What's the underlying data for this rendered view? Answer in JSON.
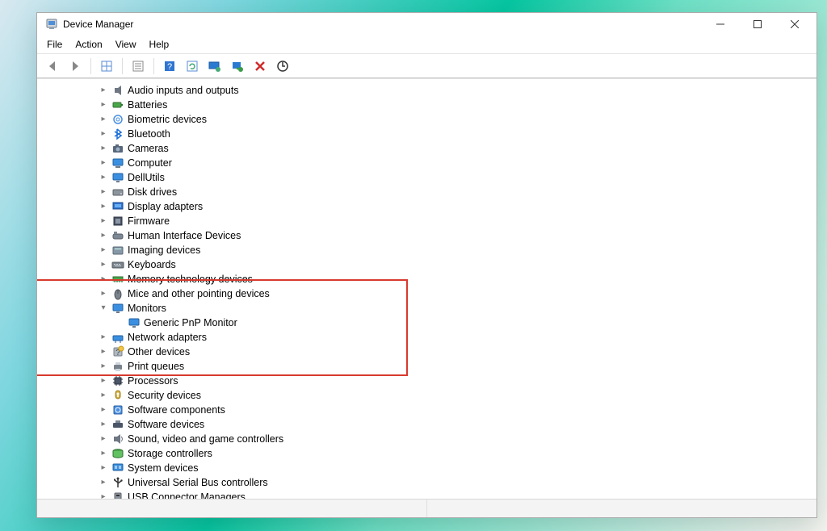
{
  "window": {
    "title": "Device Manager",
    "controls": {
      "minimize": "minimize",
      "maximize": "maximize",
      "close": "close"
    }
  },
  "menubar": [
    "File",
    "Action",
    "View",
    "Help"
  ],
  "toolbar": {
    "back": "Back",
    "forward": "Forward",
    "up_show": "Show hidden devices",
    "properties": "Properties",
    "help": "Help",
    "refresh": "Refresh",
    "update_driver": "Update driver",
    "uninstall": "Uninstall device",
    "disable": "Disable device",
    "scan": "Scan for hardware changes"
  },
  "tree": [
    {
      "label": "Audio inputs and outputs",
      "icon": "speaker",
      "state": "collapsed"
    },
    {
      "label": "Batteries",
      "icon": "battery",
      "state": "collapsed"
    },
    {
      "label": "Biometric devices",
      "icon": "biometric",
      "state": "collapsed"
    },
    {
      "label": "Bluetooth",
      "icon": "bluetooth",
      "state": "collapsed"
    },
    {
      "label": "Cameras",
      "icon": "camera",
      "state": "collapsed"
    },
    {
      "label": "Computer",
      "icon": "computer",
      "state": "collapsed"
    },
    {
      "label": "DellUtils",
      "icon": "monitor",
      "state": "collapsed"
    },
    {
      "label": "Disk drives",
      "icon": "disk",
      "state": "collapsed"
    },
    {
      "label": "Display adapters",
      "icon": "display",
      "state": "collapsed"
    },
    {
      "label": "Firmware",
      "icon": "firmware",
      "state": "collapsed"
    },
    {
      "label": "Human Interface Devices",
      "icon": "hid",
      "state": "collapsed"
    },
    {
      "label": "Imaging devices",
      "icon": "imaging",
      "state": "collapsed"
    },
    {
      "label": "Keyboards",
      "icon": "keyboard",
      "state": "collapsed"
    },
    {
      "label": "Memory technology devices",
      "icon": "memory",
      "state": "collapsed"
    },
    {
      "label": "Mice and other pointing devices",
      "icon": "mouse",
      "state": "collapsed"
    },
    {
      "label": "Monitors",
      "icon": "monitor",
      "state": "expanded",
      "children": [
        {
          "label": "Generic PnP Monitor",
          "icon": "monitor"
        }
      ]
    },
    {
      "label": "Network adapters",
      "icon": "network",
      "state": "collapsed"
    },
    {
      "label": "Other devices",
      "icon": "other",
      "state": "collapsed"
    },
    {
      "label": "Print queues",
      "icon": "printer",
      "state": "collapsed"
    },
    {
      "label": "Processors",
      "icon": "cpu",
      "state": "collapsed"
    },
    {
      "label": "Security devices",
      "icon": "security",
      "state": "collapsed"
    },
    {
      "label": "Software components",
      "icon": "softcomp",
      "state": "collapsed"
    },
    {
      "label": "Software devices",
      "icon": "softdev",
      "state": "collapsed"
    },
    {
      "label": "Sound, video and game controllers",
      "icon": "sound",
      "state": "collapsed"
    },
    {
      "label": "Storage controllers",
      "icon": "storage",
      "state": "collapsed"
    },
    {
      "label": "System devices",
      "icon": "system",
      "state": "collapsed"
    },
    {
      "label": "Universal Serial Bus controllers",
      "icon": "usb",
      "state": "collapsed"
    },
    {
      "label": "USB Connector Managers",
      "icon": "usbconn",
      "state": "collapsed"
    }
  ],
  "annotation": {
    "highlight": true
  }
}
